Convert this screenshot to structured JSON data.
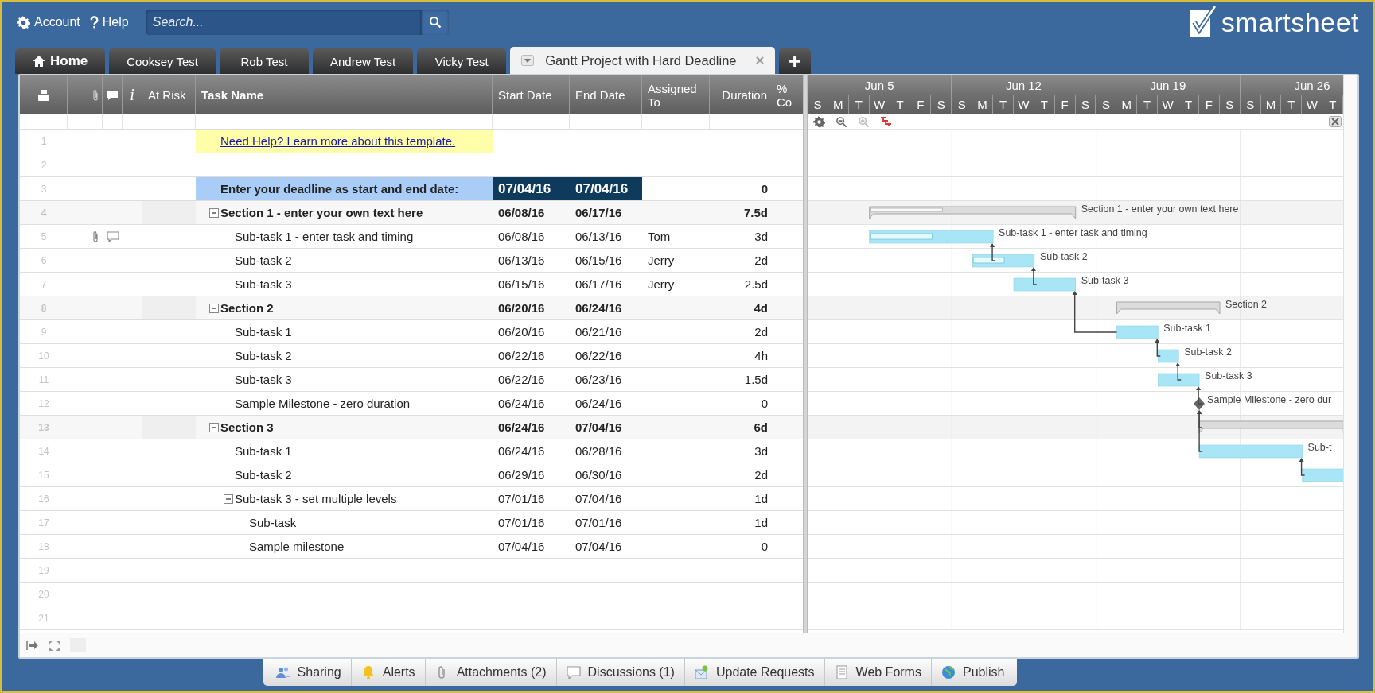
{
  "topbar": {
    "account": "Account",
    "help": "Help",
    "search": {
      "placeholder": "Search..."
    },
    "logo": "smartsheet"
  },
  "tabs": [
    {
      "label": "Home",
      "kind": "home",
      "selected": false
    },
    {
      "label": "Cooksey Test",
      "kind": "sheet",
      "selected": false
    },
    {
      "label": "Rob Test",
      "kind": "sheet",
      "selected": false
    },
    {
      "label": "Andrew Test",
      "kind": "sheet",
      "selected": false
    },
    {
      "label": "Vicky Test",
      "kind": "sheet",
      "selected": false
    },
    {
      "label": "Gantt Project with Hard Deadline",
      "kind": "sheet",
      "selected": true
    }
  ],
  "add_tab": "+",
  "columns": {
    "info": "i",
    "at_risk": "At Risk",
    "task_name": "Task Name",
    "start_date": "Start Date",
    "end_date": "End Date",
    "assigned_to": "Assigned To",
    "duration": "Duration",
    "percent_complete": "% Co"
  },
  "rows": [
    {
      "number": "1",
      "kind": "help",
      "task": "Need Help? Learn more about this template.",
      "attachment": false,
      "comment": false
    },
    {
      "number": "2",
      "kind": "blank",
      "attachment": false,
      "comment": false
    },
    {
      "number": "3",
      "kind": "deadline",
      "task": "Enter your deadline as start and end date:",
      "start": "07/04/16",
      "end": "07/04/16",
      "duration": "0",
      "attachment": false,
      "comment": false
    },
    {
      "number": "4",
      "kind": "section",
      "task": "Section 1 - enter your own text here",
      "start": "06/08/16",
      "end": "06/17/16",
      "duration": "7.5d",
      "expanded": true,
      "level": 0.35,
      "linked": false,
      "gantt_label": "Section 1 - enter your own text here",
      "attachment": false,
      "comment": false,
      "children": [
        {
          "number": "5",
          "kind": "task",
          "task": "Sub-task 1 - enter task and timing",
          "start": "06/08/16",
          "end": "06/13/16",
          "assigned": "Tom",
          "duration": "3d",
          "level": 0.5,
          "linked": false,
          "gantt_label": "Sub-task 1 - enter task and timing",
          "attachment": true,
          "comment": true
        },
        {
          "number": "6",
          "kind": "task",
          "task": "Sub-task 2",
          "start": "06/13/16",
          "end": "06/15/16",
          "assigned": "Jerry",
          "duration": "2d",
          "level": 0.5,
          "linked": true,
          "gantt_label": "Sub-task 2",
          "attachment": false,
          "comment": false
        },
        {
          "number": "7",
          "kind": "task",
          "task": "Sub-task 3",
          "start": "06/15/16",
          "end": "06/17/16",
          "assigned": "Jerry",
          "duration": "2.5d",
          "linked": true,
          "gantt_label": "Sub-task 3",
          "attachment": false,
          "comment": false
        }
      ]
    },
    {
      "number": "8",
      "kind": "section",
      "task": "Section 2",
      "start": "06/20/16",
      "end": "06/24/16",
      "duration": "4d",
      "expanded": true,
      "linked": false,
      "gantt_label": "Section 2",
      "attachment": false,
      "comment": false,
      "children": [
        {
          "number": "9",
          "kind": "task",
          "task": "Sub-task 1",
          "start": "06/20/16",
          "end": "06/21/16",
          "duration": "2d",
          "linked": true,
          "gantt_label": "Sub-task 1",
          "attachment": false,
          "comment": false
        },
        {
          "number": "10",
          "kind": "task",
          "task": "Sub-task 2",
          "start": "06/22/16",
          "end": "06/22/16",
          "duration": "4h",
          "linked": true,
          "gantt_label": "Sub-task 2",
          "attachment": false,
          "comment": false
        },
        {
          "number": "11",
          "kind": "task",
          "task": "Sub-task 3",
          "start": "06/22/16",
          "end": "06/23/16",
          "duration": "1.5d",
          "linked": true,
          "gantt_label": "Sub-task 3",
          "attachment": false,
          "comment": false
        },
        {
          "number": "12",
          "kind": "milestone",
          "task": "Sample Milestone - zero duration",
          "start": "06/24/16",
          "end": "06/24/16",
          "duration": "0",
          "linked": true,
          "gantt_label": "Sample Milestone - zero dur",
          "attachment": false,
          "comment": false
        }
      ]
    },
    {
      "number": "13",
      "kind": "section",
      "task": "Section 3",
      "start": "06/24/16",
      "end": "07/04/16",
      "duration": "6d",
      "expanded": true,
      "linked": true,
      "attachment": false,
      "comment": false,
      "children": [
        {
          "number": "14",
          "kind": "task",
          "task": "Sub-task 1",
          "start": "06/24/16",
          "end": "06/28/16",
          "duration": "3d",
          "linked": true,
          "gantt_label": "Sub-t",
          "attachment": false,
          "comment": false
        },
        {
          "number": "15",
          "kind": "task",
          "task": "Sub-task 2",
          "start": "06/29/16",
          "end": "06/30/16",
          "duration": "2d",
          "linked": true,
          "attachment": false,
          "comment": false
        },
        {
          "number": "16",
          "task": "Sub-task 3 - set multiple levels",
          "start": "07/01/16",
          "end": "07/04/16",
          "duration": "1d",
          "expanded": true,
          "attachment": false,
          "comment": false,
          "children": [
            {
              "number": "17",
              "task": "Sub-task",
              "start": "07/01/16",
              "end": "07/01/16",
              "duration": "1d",
              "attachment": false,
              "comment": false
            },
            {
              "number": "18",
              "task": "Sample milestone",
              "start": "07/04/16",
              "end": "07/04/16",
              "duration": "0",
              "attachment": false,
              "comment": false
            }
          ]
        }
      ]
    },
    {
      "number": "19",
      "kind": "blank",
      "attachment": false,
      "comment": false
    },
    {
      "number": "20",
      "kind": "blank",
      "attachment": false,
      "comment": false
    },
    {
      "number": "21",
      "kind": "blank",
      "attachment": false,
      "comment": false
    }
  ],
  "gantt": {
    "weeks": [
      "Jun 5",
      "Jun 12",
      "Jun 19",
      "Jun 26"
    ],
    "days": [
      "S",
      "M",
      "T",
      "W",
      "T",
      "F",
      "S",
      "S",
      "M",
      "T",
      "W",
      "T",
      "F",
      "S",
      "S",
      "M",
      "T",
      "W",
      "T",
      "F",
      "S",
      "S",
      "M",
      "T",
      "W",
      "T"
    ]
  },
  "bottom_bar": [
    {
      "kind": "sharing",
      "label": "Sharing"
    },
    {
      "kind": "alerts",
      "label": "Alerts"
    },
    {
      "kind": "attachments",
      "label": "Attachments (2)"
    },
    {
      "kind": "discussions",
      "label": "Discussions (1)"
    },
    {
      "kind": "update_requests",
      "label": "Update Requests"
    },
    {
      "kind": "web_forms",
      "label": "Web Forms"
    },
    {
      "kind": "publish",
      "label": "Publish"
    }
  ]
}
